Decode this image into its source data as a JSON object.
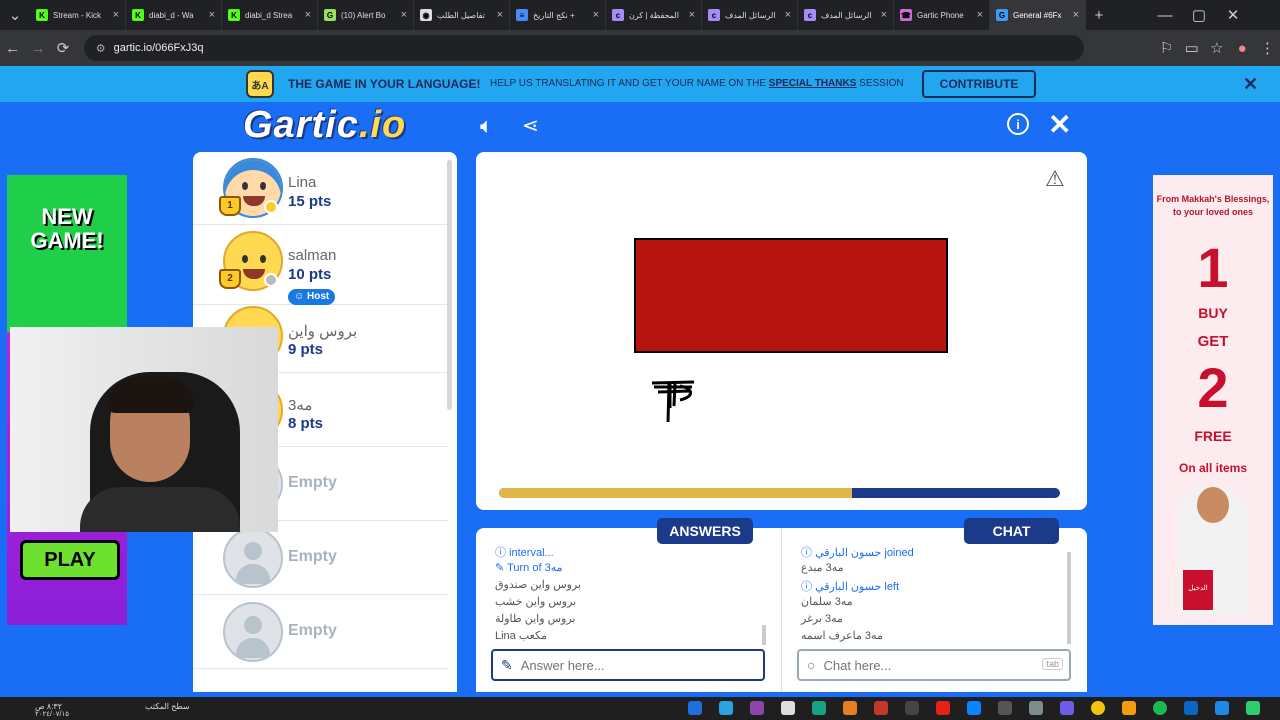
{
  "browser": {
    "tabs": [
      {
        "label": "Stream - Kick",
        "icon": "kick-icon",
        "color": "#53fc18",
        "glyph": "K"
      },
      {
        "label": "diabi_d - Wa",
        "icon": "kick-icon",
        "color": "#53fc18",
        "glyph": "K"
      },
      {
        "label": "diabi_d Strea",
        "icon": "kick-icon",
        "color": "#53fc18",
        "glyph": "K"
      },
      {
        "label": "(10) Alert Bo",
        "icon": "alert-icon",
        "color": "#9adf5f",
        "glyph": "G"
      },
      {
        "label": "تفاصيل الطلب",
        "icon": "eye-icon",
        "color": "#dddddd",
        "glyph": "◉"
      },
      {
        "label": "نكج التاريخ +",
        "icon": "docs-icon",
        "color": "#4a8af4",
        "glyph": "≡"
      },
      {
        "label": "المحفظة | كرن",
        "icon": "c-icon",
        "color": "#a78bfa",
        "glyph": "c"
      },
      {
        "label": "الرسائل المدف",
        "icon": "c-icon",
        "color": "#a78bfa",
        "glyph": "c"
      },
      {
        "label": "الرسائل المدف",
        "icon": "c-icon",
        "color": "#a78bfa",
        "glyph": "c"
      },
      {
        "label": "Gartic Phone",
        "icon": "phone-icon",
        "color": "#d06bd6",
        "glyph": "☎"
      },
      {
        "label": "General #6Fx",
        "icon": "gartic-icon",
        "color": "#3b9cf5",
        "glyph": "G"
      }
    ],
    "url": "gartic.io/066FxJ3q"
  },
  "banner": {
    "title": "THE GAME IN YOUR LANGUAGE!",
    "sub_before": "HELP US TRANSLATING IT AND GET YOUR NAME ON THE ",
    "sub_link": "SPECIAL THANKS",
    "sub_after": " SESSION",
    "button": "CONTRIBUTE"
  },
  "logo": {
    "main": "Gartic",
    "suffix": ".io"
  },
  "ads": {
    "left": {
      "headline": "NEW GAME!",
      "cta": "PLAY"
    },
    "right": {
      "tagline": "From Makkah's Blessings, to your loved ones",
      "n1": "1",
      "buy": "BUY",
      "get": "GET",
      "n2": "2",
      "free": "FREE",
      "footer": "On all items",
      "brand": "الدخيل"
    }
  },
  "players": [
    {
      "name": "Lina",
      "points": "15 pts",
      "status_color": "#ffc928",
      "avatar": "girl"
    },
    {
      "name": "salman",
      "points": "10 pts",
      "host": "Host",
      "status_color": "#bbbbbb",
      "avatar": "boy"
    },
    {
      "name": "بروس واين",
      "points": "9 pts",
      "avatar": "boy"
    },
    {
      "name": "مه3",
      "points": "8 pts",
      "avatar": "boy"
    },
    {
      "name": "Empty"
    },
    {
      "name": "Empty"
    },
    {
      "name": "Empty"
    }
  ],
  "game": {
    "timer_progress": 0.63
  },
  "answers": {
    "tab": "ANSWERS",
    "messages": [
      {
        "type": "sys",
        "text": "interval..."
      },
      {
        "type": "sys",
        "text": "Turn of مه3"
      },
      {
        "type": "norm",
        "text": "بروس واين صندوق"
      },
      {
        "type": "norm",
        "text": "بروس واين خشب"
      },
      {
        "type": "norm",
        "text": "بروس واين طاولة"
      },
      {
        "type": "norm",
        "text": "Lina مكعب"
      }
    ],
    "placeholder": "Answer here..."
  },
  "chat": {
    "tab": "CHAT",
    "messages": [
      {
        "type": "sys",
        "text": "حسون البارقي joined"
      },
      {
        "type": "norm",
        "text": "مه3 مبدع"
      },
      {
        "type": "sys",
        "text": "حسون البارقي left"
      },
      {
        "type": "norm",
        "text": "مه3 سلمان"
      },
      {
        "type": "norm",
        "text": "مه3 برغر"
      },
      {
        "type": "norm",
        "text": "مه3 ماعرف اسمه"
      }
    ],
    "placeholder": "Chat here...",
    "tab_hint": "tab"
  },
  "taskbar": {
    "clock": "٨:٣٢ ص",
    "date": "٢٠٢٤/٠٧/١٥",
    "desktop": "سطح المكتب"
  }
}
